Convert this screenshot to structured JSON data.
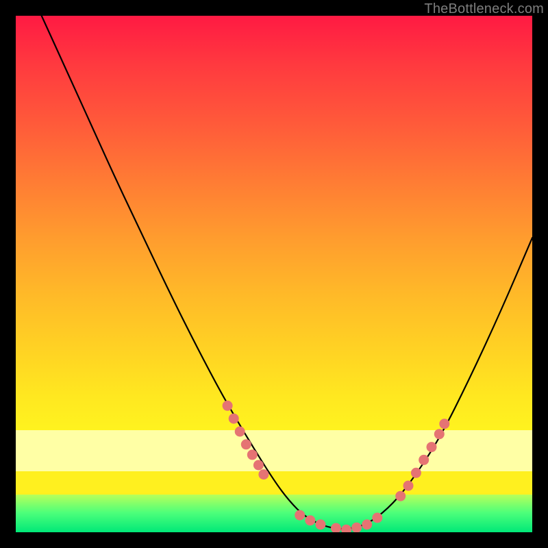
{
  "watermark": "TheBottleneck.com",
  "colors": {
    "background": "#000000",
    "gradient_top": "#ff1a43",
    "gradient_mid": "#ffd523",
    "pale_strip": "#ffffa5",
    "yellow_strip": "#fff01f",
    "green_strip": "#00e878",
    "curve": "#000000",
    "dots": "#e57373"
  },
  "chart_data": {
    "type": "line",
    "title": "",
    "xlabel": "",
    "ylabel": "",
    "xlim": [
      0,
      100
    ],
    "ylim": [
      0,
      100
    ],
    "series": [
      {
        "name": "bottleneck-curve",
        "x": [
          5,
          10,
          15,
          20,
          25,
          30,
          35,
          40,
          45,
          50,
          53,
          56,
          60,
          64,
          68,
          72,
          76,
          82,
          88,
          94,
          100
        ],
        "y": [
          100,
          89,
          78,
          67,
          56.5,
          46,
          36,
          26.5,
          18,
          10,
          6,
          3,
          1,
          0.5,
          1.5,
          4.5,
          9,
          18,
          30,
          43,
          57
        ]
      }
    ],
    "dot_clusters": [
      {
        "name": "left-arm-dots",
        "points": [
          {
            "x": 41,
            "y": 24.5
          },
          {
            "x": 42.2,
            "y": 22
          },
          {
            "x": 43.4,
            "y": 19.5
          },
          {
            "x": 44.6,
            "y": 17
          },
          {
            "x": 45.8,
            "y": 15
          },
          {
            "x": 47,
            "y": 13
          },
          {
            "x": 48,
            "y": 11.2
          }
        ]
      },
      {
        "name": "valley-dots",
        "points": [
          {
            "x": 55,
            "y": 3.3
          },
          {
            "x": 57,
            "y": 2.3
          },
          {
            "x": 59,
            "y": 1.5
          },
          {
            "x": 62,
            "y": 0.8
          },
          {
            "x": 64,
            "y": 0.5
          },
          {
            "x": 66,
            "y": 0.9
          },
          {
            "x": 68,
            "y": 1.5
          },
          {
            "x": 70,
            "y": 2.8
          }
        ]
      },
      {
        "name": "right-arm-dots",
        "points": [
          {
            "x": 74.5,
            "y": 7
          },
          {
            "x": 76,
            "y": 9
          },
          {
            "x": 77.5,
            "y": 11.5
          },
          {
            "x": 79,
            "y": 14
          },
          {
            "x": 80.5,
            "y": 16.5
          },
          {
            "x": 82,
            "y": 19
          },
          {
            "x": 83,
            "y": 21
          }
        ]
      }
    ]
  }
}
